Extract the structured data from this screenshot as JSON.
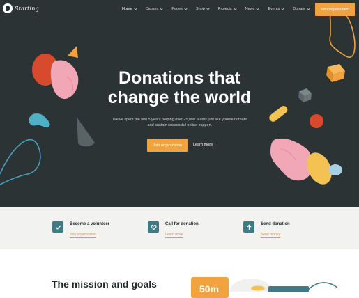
{
  "brand": {
    "name": "Starting"
  },
  "nav": {
    "items": [
      {
        "label": "Home",
        "active": true
      },
      {
        "label": "Causes"
      },
      {
        "label": "Pages"
      },
      {
        "label": "Shop"
      },
      {
        "label": "Projects"
      },
      {
        "label": "News"
      },
      {
        "label": "Events"
      },
      {
        "label": "Donate"
      }
    ],
    "cta": "Join organization"
  },
  "hero": {
    "title_line1": "Donations that",
    "title_line2": "change the world",
    "subtitle": "We've spent the last 5 years helping over 25,000 teams just like yourself create and sustain successful online support.",
    "primary_button": "Join organization",
    "secondary_link": "Learn more"
  },
  "features": [
    {
      "title": "Become a volunteer",
      "link": "Join organization",
      "icon": "check-icon"
    },
    {
      "title": "Call for donation",
      "link": "Learn more",
      "icon": "heart-icon"
    },
    {
      "title": "Send donation",
      "link": "Send money",
      "icon": "arrow-up-icon"
    }
  ],
  "mission": {
    "title": "The mission and goals",
    "stat": "50m"
  },
  "colors": {
    "hero_bg": "#2b3335",
    "accent": "#f0a33e",
    "teal": "#3e7b86",
    "features_bg": "#f2f2f0"
  }
}
